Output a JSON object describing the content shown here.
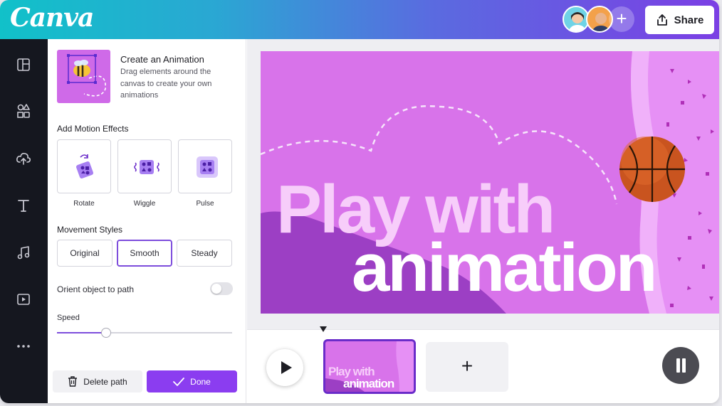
{
  "app": {
    "logo_text": "Canva"
  },
  "header": {
    "share_label": "Share",
    "add_collaborator_symbol": "+",
    "collaborators": [
      "collaborator-1",
      "collaborator-2"
    ]
  },
  "rail": {
    "icons": [
      "layout-icon",
      "elements-icon",
      "upload-icon",
      "text-icon",
      "music-icon",
      "video-icon",
      "more-icon"
    ]
  },
  "panel": {
    "hero_title": "Create an Animation",
    "hero_description": "Drag elements around the canvas to create your own animations",
    "motion_effects_label": "Add Motion Effects",
    "effects": [
      {
        "label": "Rotate"
      },
      {
        "label": "Wiggle"
      },
      {
        "label": "Pulse"
      }
    ],
    "movement_styles_label": "Movement Styles",
    "styles": [
      {
        "label": "Original",
        "selected": false
      },
      {
        "label": "Smooth",
        "selected": true
      },
      {
        "label": "Steady",
        "selected": false
      }
    ],
    "orient_label": "Orient object to path",
    "orient_enabled": false,
    "speed_label": "Speed",
    "speed_fraction": 0.28,
    "delete_label": "Delete path",
    "done_label": "Done"
  },
  "canvas": {
    "headline_line1": "Play with",
    "headline_line2": "animation",
    "background_color": "#d873ea"
  },
  "timeline": {
    "thumb_line1": "Play with",
    "thumb_line2": "animation",
    "add_page_symbol": "+"
  },
  "colors": {
    "accent": "#8b3df0",
    "rail_bg": "#15171f",
    "selected_border": "#7d4ddc"
  }
}
